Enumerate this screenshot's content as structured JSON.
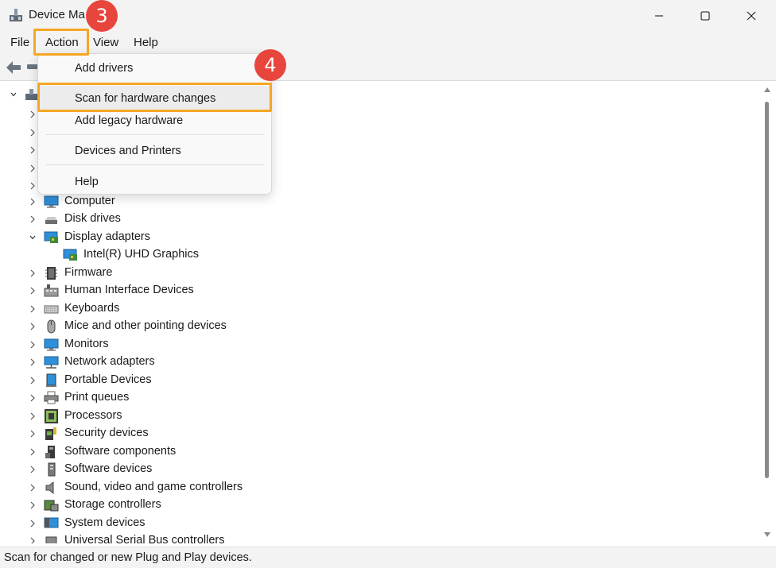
{
  "window": {
    "title": "Device Manager",
    "title_visible": "Device Ma",
    "controls": [
      "minimize",
      "maximize",
      "close"
    ]
  },
  "menubar": {
    "items": [
      {
        "label": "File"
      },
      {
        "label": "Action"
      },
      {
        "label": "View"
      },
      {
        "label": "Help"
      }
    ]
  },
  "toolbar": {
    "icons": [
      "back-arrow-icon",
      "forward-arrow-icon"
    ]
  },
  "action_menu": {
    "items": [
      {
        "label": "Add drivers"
      },
      {
        "label": "Scan for hardware changes"
      },
      {
        "label": "Add legacy hardware"
      },
      {
        "label": "Devices and Printers"
      },
      {
        "label": "Help"
      }
    ]
  },
  "tree": {
    "items": [
      {
        "label": "Computer",
        "icon": "monitor-icon",
        "expanded": false
      },
      {
        "label": "Disk drives",
        "icon": "disk-drive-icon",
        "expanded": false
      },
      {
        "label": "Display adapters",
        "icon": "display-adapter-icon",
        "expanded": true
      },
      {
        "label": "Intel(R) UHD Graphics",
        "icon": "display-adapter-icon",
        "child": true
      },
      {
        "label": "Firmware",
        "icon": "firmware-icon",
        "expanded": false
      },
      {
        "label": "Human Interface Devices",
        "icon": "hid-icon",
        "expanded": false
      },
      {
        "label": "Keyboards",
        "icon": "keyboard-icon",
        "expanded": false
      },
      {
        "label": "Mice and other pointing devices",
        "icon": "mouse-icon",
        "expanded": false
      },
      {
        "label": "Monitors",
        "icon": "monitor-icon",
        "expanded": false
      },
      {
        "label": "Network adapters",
        "icon": "network-icon",
        "expanded": false
      },
      {
        "label": "Portable Devices",
        "icon": "portable-device-icon",
        "expanded": false
      },
      {
        "label": "Print queues",
        "icon": "printer-icon",
        "expanded": false
      },
      {
        "label": "Processors",
        "icon": "processor-icon",
        "expanded": false
      },
      {
        "label": "Security devices",
        "icon": "security-device-icon",
        "expanded": false
      },
      {
        "label": "Software components",
        "icon": "software-component-icon",
        "expanded": false
      },
      {
        "label": "Software devices",
        "icon": "software-device-icon",
        "expanded": false
      },
      {
        "label": "Sound, video and game controllers",
        "icon": "speaker-icon",
        "expanded": false
      },
      {
        "label": "Storage controllers",
        "icon": "storage-controller-icon",
        "expanded": false
      },
      {
        "label": "System devices",
        "icon": "system-device-icon",
        "expanded": false
      },
      {
        "label": "Universal Serial Bus controllers",
        "icon": "usb-icon",
        "expanded": false
      }
    ]
  },
  "statusbar": {
    "text": "Scan for changed or new Plug and Play devices."
  },
  "annotations": {
    "step_menu": "3",
    "step_item": "4",
    "highlight_color": "#f5a623",
    "badge_color": "#e8453c"
  }
}
